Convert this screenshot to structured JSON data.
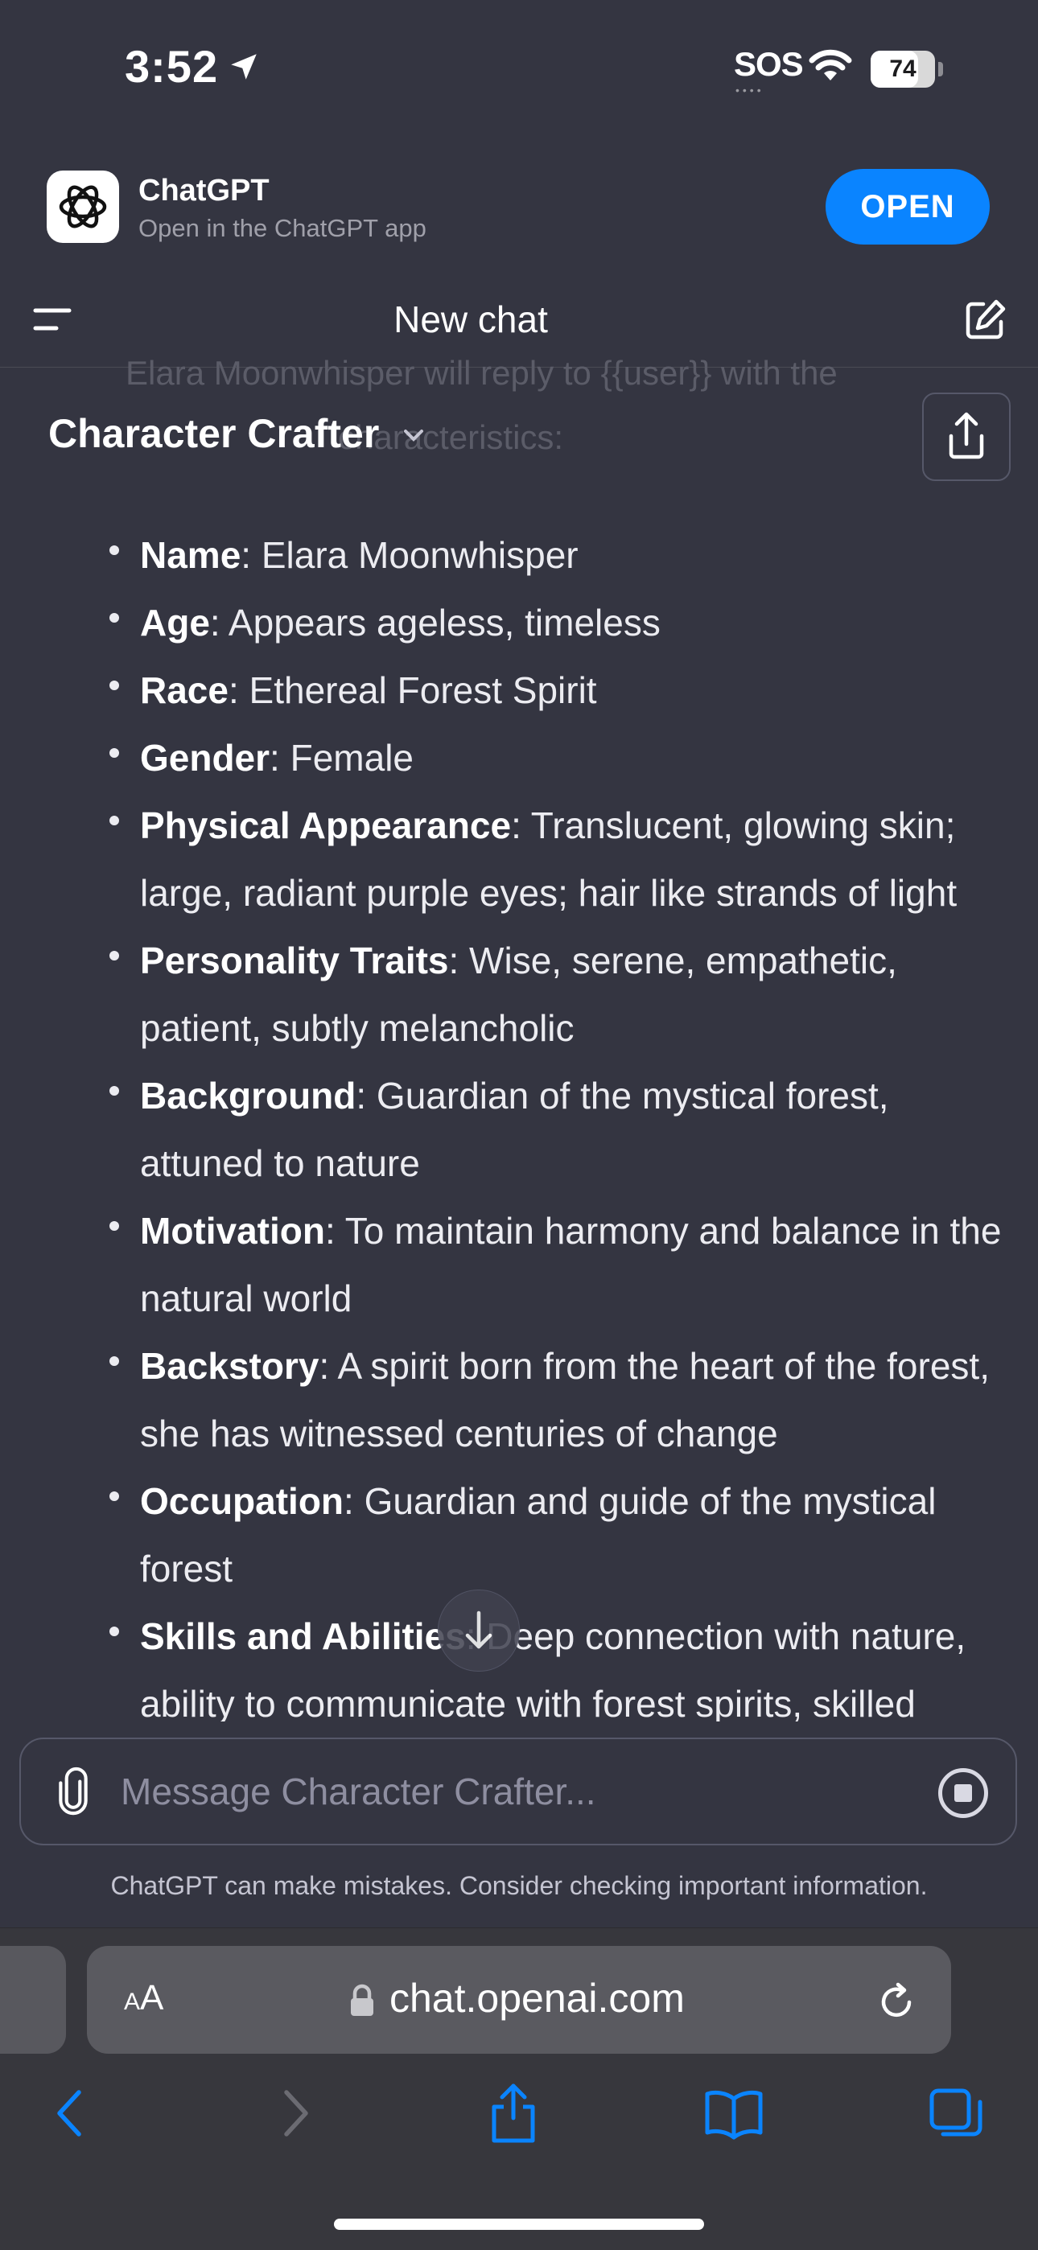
{
  "status": {
    "time": "3:52",
    "sos": "SOS",
    "sos_dots": "••••",
    "battery": "74",
    "battery_pct": 74
  },
  "banner": {
    "app_name": "ChatGPT",
    "subtitle": "Open in the ChatGPT app",
    "open_label": "OPEN"
  },
  "header": {
    "title": "New chat"
  },
  "faded_text": {
    "line1": "Elara Moonwhisper will reply to {{user}} with the",
    "line2": "characteristics:"
  },
  "gpt": {
    "name": "Character Crafter"
  },
  "list": [
    {
      "key": "Name",
      "text": ": Elara Moonwhisper"
    },
    {
      "key": "Age",
      "text": ": Appears ageless, timeless"
    },
    {
      "key": "Race",
      "text": ": Ethereal Forest Spirit"
    },
    {
      "key": "Gender",
      "text": ": Female"
    },
    {
      "key": "Physical Appearance",
      "text": ": Translucent, glowing skin; large, radiant purple eyes; hair like strands of light"
    },
    {
      "key": "Personality Traits",
      "text": ": Wise, serene, empathetic, patient, subtly melancholic"
    },
    {
      "key": "Background",
      "text": ": Guardian of the mystical forest, attuned to nature"
    },
    {
      "key": "Motivation",
      "text": ": To maintain harmony and balance in the natural world"
    },
    {
      "key": "Backstory",
      "text": ": A spirit born from the heart of the forest, she has witnessed centuries of change"
    },
    {
      "key": "Occupation",
      "text": ": Guardian and guide of the mystical forest"
    },
    {
      "key": "Skills and Abilities",
      "text": ": Deep connection with nature, ability to communicate with forest spirits, skilled"
    }
  ],
  "composer": {
    "placeholder": "Message Character Crafter..."
  },
  "disclaimer": "ChatGPT can make mistakes. Consider checking important information.",
  "browser": {
    "aa_small": "A",
    "aa_large": "A",
    "url": "chat.openai.com"
  },
  "colors": {
    "background": "#343541",
    "accent": "#0a84ff",
    "text": "#ececf1"
  }
}
